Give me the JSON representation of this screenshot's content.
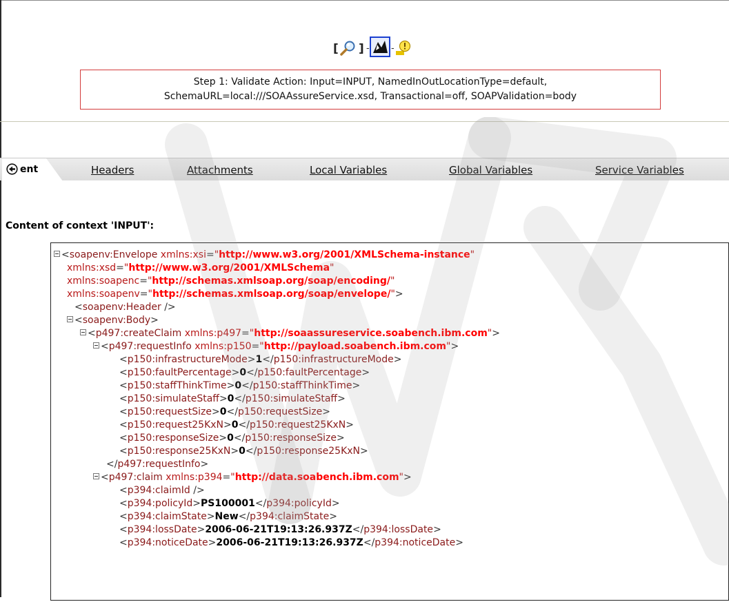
{
  "toolbar": {
    "left_bracket": "[",
    "right_bracket": "]",
    "dash1": "-",
    "dash2": "-",
    "icons": [
      "magnifier-icon",
      "probe-icon",
      "lightbulb-icon"
    ]
  },
  "step": {
    "line1": "Step 1: Validate Action: Input=INPUT, NamedInOutLocationType=default,",
    "line2": "SchemaURL=local:///SOAAssureService.xsd, Transactional=off, SOAPValidation=body"
  },
  "tabs": {
    "active": "ent",
    "items": [
      "Headers",
      "Attachments",
      "Local Variables",
      "Global Variables",
      "Service Variables"
    ]
  },
  "content_heading": "Content of context 'INPUT':",
  "colors": {
    "accent_red": "#d23a3a",
    "attr_value": "#ff0000",
    "tag": "#8a1a1a"
  },
  "xml": {
    "l1": {
      "open": "<",
      "tag": "soapenv:Envelope",
      "attr": " xmlns:xsi",
      "eq": "=",
      "val": "http://www.w3.org/2001/XMLSchema-instance"
    },
    "l2": {
      "attr": "xmlns:xsd",
      "eq": "=",
      "val": "http://www.w3.org/2001/XMLSchema"
    },
    "l3": {
      "attr": "xmlns:soapenc",
      "eq": "=",
      "val": "http://schemas.xmlsoap.org/soap/encoding/"
    },
    "l4": {
      "attr": "xmlns:soapenv",
      "eq": "=",
      "val": "http://schemas.xmlsoap.org/soap/envelope/",
      "close": ">"
    },
    "l5": {
      "open": "<",
      "tag": "soapenv:Header",
      "close": " />"
    },
    "l6": {
      "open": "<",
      "tag": "soapenv:Body",
      "close": ">"
    },
    "l7": {
      "open": "<",
      "tag": "p497:createClaim",
      "attr": " xmlns:p497",
      "eq": "=",
      "val": "http://soaassureservice.soabench.ibm.com",
      "close": ">"
    },
    "l8": {
      "open": "<",
      "tag": "p497:requestInfo",
      "attr": " xmlns:p150",
      "eq": "=",
      "val": "http://payload.soabench.ibm.com",
      "close": ">"
    },
    "l9": {
      "tag": "p150:infrastructureMode",
      "text": "1"
    },
    "l10": {
      "tag": "p150:faultPercentage",
      "text": "0"
    },
    "l11": {
      "tag": "p150:staffThinkTime",
      "text": "0"
    },
    "l12": {
      "tag": "p150:simulateStaff",
      "text": "0"
    },
    "l13": {
      "tag": "p150:requestSize",
      "text": "0"
    },
    "l14": {
      "tag": "p150:request25KxN",
      "text": "0"
    },
    "l15": {
      "tag": "p150:responseSize",
      "text": "0"
    },
    "l16": {
      "tag": "p150:response25KxN",
      "text": "0"
    },
    "l17": {
      "open": "</",
      "tag": "p497:requestInfo",
      "close": ">"
    },
    "l18": {
      "open": "<",
      "tag": "p497:claim",
      "attr": " xmlns:p394",
      "eq": "=",
      "val": "http://data.soabench.ibm.com",
      "close": ">"
    },
    "l19": {
      "open": "<",
      "tag": "p394:claimId",
      "close": " />"
    },
    "l20": {
      "tag": "p394:policyId",
      "text": "PS100001"
    },
    "l21": {
      "tag": "p394:claimState",
      "text": "New"
    },
    "l22": {
      "tag": "p394:lossDate",
      "text": "2006-06-21T19:13:26.937Z"
    },
    "l23": {
      "tag": "p394:noticeDate",
      "text": "2006-06-21T19:13:26.937Z"
    },
    "lt": "<",
    "lt_close": "</",
    "gt": ">",
    "quote": "\""
  }
}
